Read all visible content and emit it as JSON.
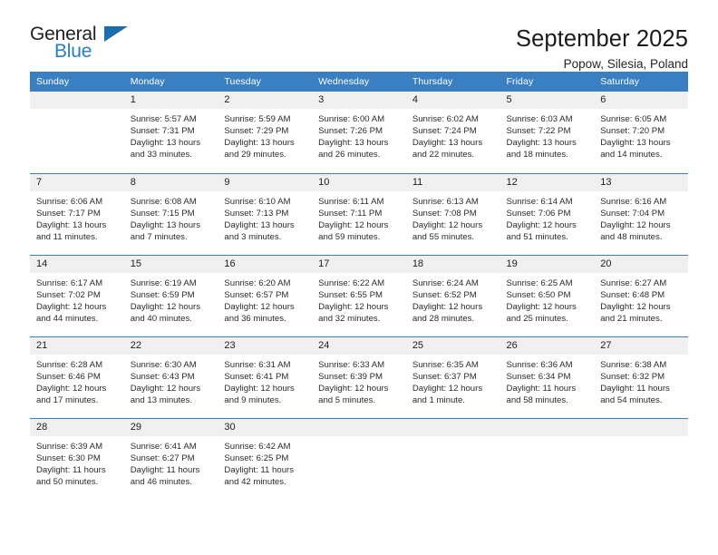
{
  "brand": {
    "name_part1": "General",
    "name_part2": "Blue",
    "logo_icon": "triangle-logo-icon",
    "accent_color": "#2680c2"
  },
  "header": {
    "title": "September 2025",
    "subtitle": "Popow, Silesia, Poland"
  },
  "theme": {
    "header_bg": "#3a7fc1",
    "daynum_bg": "#f0f0f0",
    "text_color": "#202020"
  },
  "calendar": {
    "weekday_headers": [
      "Sunday",
      "Monday",
      "Tuesday",
      "Wednesday",
      "Thursday",
      "Friday",
      "Saturday"
    ],
    "weeks": [
      [
        {
          "day": "",
          "text": ""
        },
        {
          "day": "1",
          "text": "Sunrise: 5:57 AM\nSunset: 7:31 PM\nDaylight: 13 hours and 33 minutes."
        },
        {
          "day": "2",
          "text": "Sunrise: 5:59 AM\nSunset: 7:29 PM\nDaylight: 13 hours and 29 minutes."
        },
        {
          "day": "3",
          "text": "Sunrise: 6:00 AM\nSunset: 7:26 PM\nDaylight: 13 hours and 26 minutes."
        },
        {
          "day": "4",
          "text": "Sunrise: 6:02 AM\nSunset: 7:24 PM\nDaylight: 13 hours and 22 minutes."
        },
        {
          "day": "5",
          "text": "Sunrise: 6:03 AM\nSunset: 7:22 PM\nDaylight: 13 hours and 18 minutes."
        },
        {
          "day": "6",
          "text": "Sunrise: 6:05 AM\nSunset: 7:20 PM\nDaylight: 13 hours and 14 minutes."
        }
      ],
      [
        {
          "day": "7",
          "text": "Sunrise: 6:06 AM\nSunset: 7:17 PM\nDaylight: 13 hours and 11 minutes."
        },
        {
          "day": "8",
          "text": "Sunrise: 6:08 AM\nSunset: 7:15 PM\nDaylight: 13 hours and 7 minutes."
        },
        {
          "day": "9",
          "text": "Sunrise: 6:10 AM\nSunset: 7:13 PM\nDaylight: 13 hours and 3 minutes."
        },
        {
          "day": "10",
          "text": "Sunrise: 6:11 AM\nSunset: 7:11 PM\nDaylight: 12 hours and 59 minutes."
        },
        {
          "day": "11",
          "text": "Sunrise: 6:13 AM\nSunset: 7:08 PM\nDaylight: 12 hours and 55 minutes."
        },
        {
          "day": "12",
          "text": "Sunrise: 6:14 AM\nSunset: 7:06 PM\nDaylight: 12 hours and 51 minutes."
        },
        {
          "day": "13",
          "text": "Sunrise: 6:16 AM\nSunset: 7:04 PM\nDaylight: 12 hours and 48 minutes."
        }
      ],
      [
        {
          "day": "14",
          "text": "Sunrise: 6:17 AM\nSunset: 7:02 PM\nDaylight: 12 hours and 44 minutes."
        },
        {
          "day": "15",
          "text": "Sunrise: 6:19 AM\nSunset: 6:59 PM\nDaylight: 12 hours and 40 minutes."
        },
        {
          "day": "16",
          "text": "Sunrise: 6:20 AM\nSunset: 6:57 PM\nDaylight: 12 hours and 36 minutes."
        },
        {
          "day": "17",
          "text": "Sunrise: 6:22 AM\nSunset: 6:55 PM\nDaylight: 12 hours and 32 minutes."
        },
        {
          "day": "18",
          "text": "Sunrise: 6:24 AM\nSunset: 6:52 PM\nDaylight: 12 hours and 28 minutes."
        },
        {
          "day": "19",
          "text": "Sunrise: 6:25 AM\nSunset: 6:50 PM\nDaylight: 12 hours and 25 minutes."
        },
        {
          "day": "20",
          "text": "Sunrise: 6:27 AM\nSunset: 6:48 PM\nDaylight: 12 hours and 21 minutes."
        }
      ],
      [
        {
          "day": "21",
          "text": "Sunrise: 6:28 AM\nSunset: 6:46 PM\nDaylight: 12 hours and 17 minutes."
        },
        {
          "day": "22",
          "text": "Sunrise: 6:30 AM\nSunset: 6:43 PM\nDaylight: 12 hours and 13 minutes."
        },
        {
          "day": "23",
          "text": "Sunrise: 6:31 AM\nSunset: 6:41 PM\nDaylight: 12 hours and 9 minutes."
        },
        {
          "day": "24",
          "text": "Sunrise: 6:33 AM\nSunset: 6:39 PM\nDaylight: 12 hours and 5 minutes."
        },
        {
          "day": "25",
          "text": "Sunrise: 6:35 AM\nSunset: 6:37 PM\nDaylight: 12 hours and 1 minute."
        },
        {
          "day": "26",
          "text": "Sunrise: 6:36 AM\nSunset: 6:34 PM\nDaylight: 11 hours and 58 minutes."
        },
        {
          "day": "27",
          "text": "Sunrise: 6:38 AM\nSunset: 6:32 PM\nDaylight: 11 hours and 54 minutes."
        }
      ],
      [
        {
          "day": "28",
          "text": "Sunrise: 6:39 AM\nSunset: 6:30 PM\nDaylight: 11 hours and 50 minutes."
        },
        {
          "day": "29",
          "text": "Sunrise: 6:41 AM\nSunset: 6:27 PM\nDaylight: 11 hours and 46 minutes."
        },
        {
          "day": "30",
          "text": "Sunrise: 6:42 AM\nSunset: 6:25 PM\nDaylight: 11 hours and 42 minutes."
        },
        {
          "day": "",
          "text": ""
        },
        {
          "day": "",
          "text": ""
        },
        {
          "day": "",
          "text": ""
        },
        {
          "day": "",
          "text": ""
        }
      ]
    ]
  }
}
